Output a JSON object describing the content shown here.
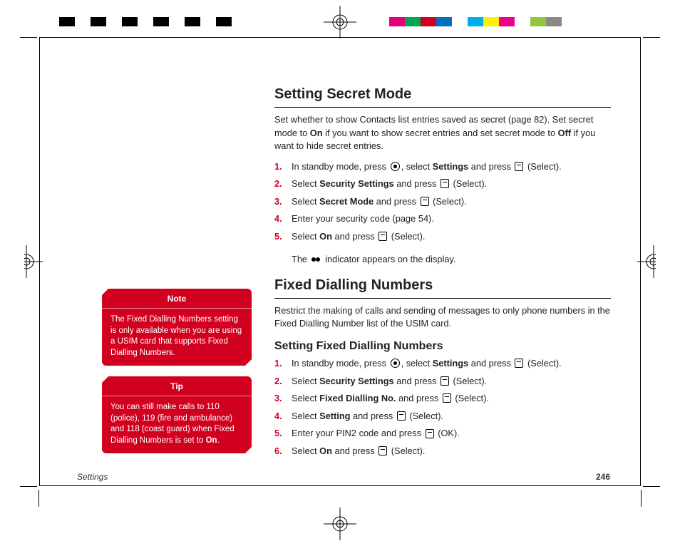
{
  "colorbar_left": [
    "#000000",
    "#ffffff",
    "#000000",
    "#ffffff",
    "#000000",
    "#ffffff",
    "#000000",
    "#ffffff",
    "#000000",
    "#ffffff",
    "#000000",
    "#ffffff"
  ],
  "colorbar_right": [
    "#e5007e",
    "#00a551",
    "#d2001f",
    "#0071bc",
    "#ffffff",
    "#00aeef",
    "#fff200",
    "#ec008c",
    "#ffffff",
    "#8dc63f",
    "#898989",
    "#ffffff"
  ],
  "heading1": "Setting Secret Mode",
  "intro1_a": "Set whether to show Contacts list entries saved as secret (page 82). Set secret mode to ",
  "intro1_b": " if you want to show secret entries and set secret mode to ",
  "intro1_c": " if you want to hide secret entries.",
  "on": "On",
  "off": "Off",
  "steps1": {
    "1a": "In standby mode, press ",
    "1b": ", select ",
    "1c": "Settings",
    "1d": " and press ",
    "1e": " (Select).",
    "2a": "Select ",
    "2b": "Security Settings",
    "2c": " and press ",
    "2d": " (Select).",
    "3a": "Select ",
    "3b": "Secret Mode",
    "3c": " and press ",
    "3d": " (Select).",
    "4a": "Enter your security code (page 54).",
    "5a": "Select ",
    "5b": "On",
    "5c": " and press ",
    "5d": " (Select)."
  },
  "result1_a": "The ",
  "result1_b": " indicator appears on the display.",
  "heading2": "Fixed Dialling Numbers",
  "intro2": "Restrict the making of calls and sending of messages to only phone numbers in the Fixed Dialling Number list of the USIM card.",
  "sub2": "Setting Fixed Dialling Numbers",
  "steps2": {
    "1a": "In standby mode, press ",
    "1b": ", select ",
    "1c": "Settings",
    "1d": " and press ",
    "1e": " (Select).",
    "2a": "Select ",
    "2b": "Security Settings",
    "2c": " and press ",
    "2d": " (Select).",
    "3a": "Select ",
    "3b": "Fixed Dialling No.",
    "3c": " and press ",
    "3d": " (Select).",
    "4a": "Select ",
    "4b": "Setting",
    "4c": " and press ",
    "4d": " (Select).",
    "5a": "Enter your PIN2 code and press ",
    "5b": " (OK).",
    "6a": "Select ",
    "6b": "On",
    "6c": " and press ",
    "6d": " (Select)."
  },
  "nums": {
    "1": "1.",
    "2": "2.",
    "3": "3.",
    "4": "4.",
    "5": "5.",
    "6": "6."
  },
  "note": {
    "title": "Note",
    "body": "The Fixed Dialling Numbers setting is only available when you are using a USIM card that supports Fixed Dialling Numbers."
  },
  "tip": {
    "title": "Tip",
    "body_a": "You can still make calls to 110 (police), 119 (fire and ambulance) and 118 (coast guard) when Fixed Dialling Numbers is set to ",
    "body_b": "."
  },
  "footer": {
    "section": "Settings",
    "page": "246"
  }
}
